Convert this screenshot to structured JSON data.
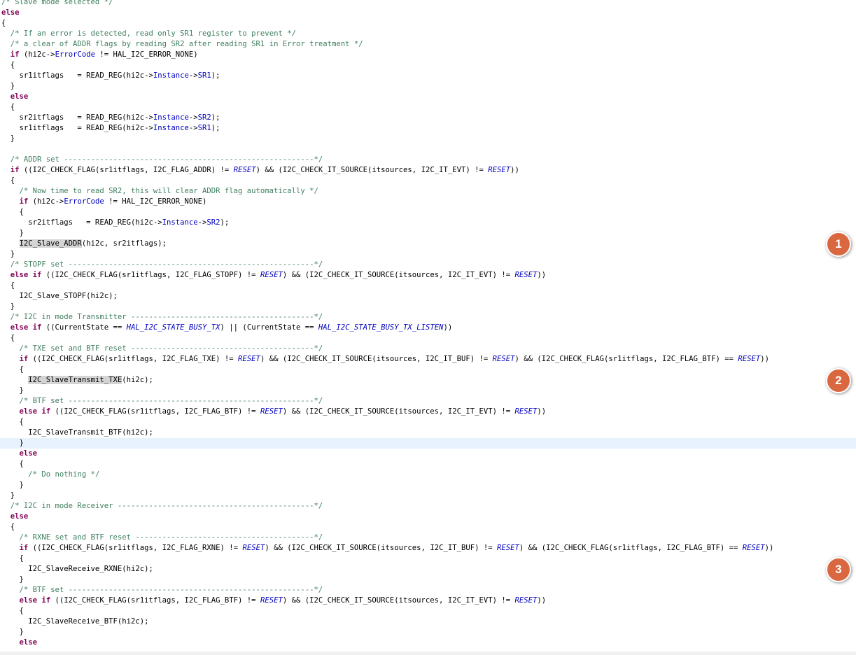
{
  "editor": {
    "current_line": 42,
    "lines": [
      [
        [
          "cm",
          "/* Slave mode selected */"
        ]
      ],
      [
        [
          "kw",
          "else"
        ]
      ],
      [
        [
          "t",
          "{"
        ]
      ],
      [
        [
          "t",
          "  "
        ],
        [
          "cm",
          "/* If an error is detected, read only SR1 register to prevent */"
        ]
      ],
      [
        [
          "t",
          "  "
        ],
        [
          "cm",
          "/* a clear of ADDR flags by reading SR2 after reading SR1 in Error treatment */"
        ]
      ],
      [
        [
          "t",
          "  "
        ],
        [
          "kw",
          "if"
        ],
        [
          "t",
          " (hi2c->"
        ],
        [
          "fld",
          "ErrorCode"
        ],
        [
          "t",
          " != HAL_I2C_ERROR_NONE)"
        ]
      ],
      [
        [
          "t",
          "  {"
        ]
      ],
      [
        [
          "t",
          "    sr1itflags   = READ_REG(hi2c->"
        ],
        [
          "fld",
          "Instance"
        ],
        [
          "t",
          "->"
        ],
        [
          "fld",
          "SR1"
        ],
        [
          "t",
          ");"
        ]
      ],
      [
        [
          "t",
          "  }"
        ]
      ],
      [
        [
          "t",
          "  "
        ],
        [
          "kw",
          "else"
        ]
      ],
      [
        [
          "t",
          "  {"
        ]
      ],
      [
        [
          "t",
          "    sr2itflags   = READ_REG(hi2c->"
        ],
        [
          "fld",
          "Instance"
        ],
        [
          "t",
          "->"
        ],
        [
          "fld",
          "SR2"
        ],
        [
          "t",
          ");"
        ]
      ],
      [
        [
          "t",
          "    sr1itflags   = READ_REG(hi2c->"
        ],
        [
          "fld",
          "Instance"
        ],
        [
          "t",
          "->"
        ],
        [
          "fld",
          "SR1"
        ],
        [
          "t",
          ");"
        ]
      ],
      [
        [
          "t",
          "  }"
        ]
      ],
      [],
      [
        [
          "t",
          "  "
        ],
        [
          "cm",
          "/* ADDR set --------------------------------------------------------*/"
        ]
      ],
      [
        [
          "t",
          "  "
        ],
        [
          "kw",
          "if"
        ],
        [
          "t",
          " ((I2C_CHECK_FLAG(sr1itflags, I2C_FLAG_ADDR) != "
        ],
        [
          "mac",
          "RESET"
        ],
        [
          "t",
          ") && (I2C_CHECK_IT_SOURCE(itsources, I2C_IT_EVT) != "
        ],
        [
          "mac",
          "RESET"
        ],
        [
          "t",
          "))"
        ]
      ],
      [
        [
          "t",
          "  {"
        ]
      ],
      [
        [
          "t",
          "    "
        ],
        [
          "cm",
          "/* Now time to read SR2, this will clear ADDR flag automatically */"
        ]
      ],
      [
        [
          "t",
          "    "
        ],
        [
          "kw",
          "if"
        ],
        [
          "t",
          " (hi2c->"
        ],
        [
          "fld",
          "ErrorCode"
        ],
        [
          "t",
          " != HAL_I2C_ERROR_NONE)"
        ]
      ],
      [
        [
          "t",
          "    {"
        ]
      ],
      [
        [
          "t",
          "      sr2itflags   = READ_REG(hi2c->"
        ],
        [
          "fld",
          "Instance"
        ],
        [
          "t",
          "->"
        ],
        [
          "fld",
          "SR2"
        ],
        [
          "t",
          ");"
        ]
      ],
      [
        [
          "t",
          "    }"
        ]
      ],
      [
        [
          "t",
          "    "
        ],
        [
          "sel",
          "I2C_Slave_ADDR"
        ],
        [
          "t",
          "(hi2c, sr2itflags);"
        ]
      ],
      [
        [
          "t",
          "  }"
        ]
      ],
      [
        [
          "t",
          "  "
        ],
        [
          "cm",
          "/* STOPF set -------------------------------------------------------*/"
        ]
      ],
      [
        [
          "t",
          "  "
        ],
        [
          "kw",
          "else if"
        ],
        [
          "t",
          " ((I2C_CHECK_FLAG(sr1itflags, I2C_FLAG_STOPF) != "
        ],
        [
          "mac",
          "RESET"
        ],
        [
          "t",
          ") && (I2C_CHECK_IT_SOURCE(itsources, I2C_IT_EVT) != "
        ],
        [
          "mac",
          "RESET"
        ],
        [
          "t",
          "))"
        ]
      ],
      [
        [
          "t",
          "  {"
        ]
      ],
      [
        [
          "t",
          "    I2C_Slave_STOPF(hi2c);"
        ]
      ],
      [
        [
          "t",
          "  }"
        ]
      ],
      [
        [
          "t",
          "  "
        ],
        [
          "cm",
          "/* I2C in mode Transmitter -----------------------------------------*/"
        ]
      ],
      [
        [
          "t",
          "  "
        ],
        [
          "kw",
          "else if"
        ],
        [
          "t",
          " ((CurrentState == "
        ],
        [
          "mac",
          "HAL_I2C_STATE_BUSY_TX"
        ],
        [
          "t",
          ") || (CurrentState == "
        ],
        [
          "mac",
          "HAL_I2C_STATE_BUSY_TX_LISTEN"
        ],
        [
          "t",
          "))"
        ]
      ],
      [
        [
          "t",
          "  {"
        ]
      ],
      [
        [
          "t",
          "    "
        ],
        [
          "cm",
          "/* TXE set and BTF reset -----------------------------------------*/"
        ]
      ],
      [
        [
          "t",
          "    "
        ],
        [
          "kw",
          "if"
        ],
        [
          "t",
          " ((I2C_CHECK_FLAG(sr1itflags, I2C_FLAG_TXE) != "
        ],
        [
          "mac",
          "RESET"
        ],
        [
          "t",
          ") && (I2C_CHECK_IT_SOURCE(itsources, I2C_IT_BUF) != "
        ],
        [
          "mac",
          "RESET"
        ],
        [
          "t",
          ") && (I2C_CHECK_FLAG(sr1itflags, I2C_FLAG_BTF) == "
        ],
        [
          "mac",
          "RESET"
        ],
        [
          "t",
          "))"
        ]
      ],
      [
        [
          "t",
          "    {"
        ]
      ],
      [
        [
          "t",
          "      "
        ],
        [
          "sel",
          "I2C_SlaveTransmit_TXE"
        ],
        [
          "t",
          "(hi2c);"
        ]
      ],
      [
        [
          "t",
          "    }"
        ]
      ],
      [
        [
          "t",
          "    "
        ],
        [
          "cm",
          "/* BTF set -------------------------------------------------------*/"
        ]
      ],
      [
        [
          "t",
          "    "
        ],
        [
          "kw",
          "else if"
        ],
        [
          "t",
          " ((I2C_CHECK_FLAG(sr1itflags, I2C_FLAG_BTF) != "
        ],
        [
          "mac",
          "RESET"
        ],
        [
          "t",
          ") && (I2C_CHECK_IT_SOURCE(itsources, I2C_IT_EVT) != "
        ],
        [
          "mac",
          "RESET"
        ],
        [
          "t",
          "))"
        ]
      ],
      [
        [
          "t",
          "    {"
        ]
      ],
      [
        [
          "t",
          "      I2C_SlaveTransmit_BTF(hi2c);"
        ]
      ],
      [
        [
          "t",
          "    }"
        ]
      ],
      [
        [
          "t",
          "    "
        ],
        [
          "kw",
          "else"
        ]
      ],
      [
        [
          "t",
          "    {"
        ]
      ],
      [
        [
          "t",
          "      "
        ],
        [
          "cm",
          "/* Do nothing */"
        ]
      ],
      [
        [
          "t",
          "    }"
        ]
      ],
      [
        [
          "t",
          "  }"
        ]
      ],
      [
        [
          "t",
          "  "
        ],
        [
          "cm",
          "/* I2C in mode Receiver --------------------------------------------*/"
        ]
      ],
      [
        [
          "t",
          "  "
        ],
        [
          "kw",
          "else"
        ]
      ],
      [
        [
          "t",
          "  {"
        ]
      ],
      [
        [
          "t",
          "    "
        ],
        [
          "cm",
          "/* RXNE set and BTF reset ----------------------------------------*/"
        ]
      ],
      [
        [
          "t",
          "    "
        ],
        [
          "kw",
          "if"
        ],
        [
          "t",
          " ((I2C_CHECK_FLAG(sr1itflags, I2C_FLAG_RXNE) != "
        ],
        [
          "mac",
          "RESET"
        ],
        [
          "t",
          ") && (I2C_CHECK_IT_SOURCE(itsources, I2C_IT_BUF) != "
        ],
        [
          "mac",
          "RESET"
        ],
        [
          "t",
          ") && (I2C_CHECK_FLAG(sr1itflags, I2C_FLAG_BTF) == "
        ],
        [
          "mac",
          "RESET"
        ],
        [
          "t",
          "))"
        ]
      ],
      [
        [
          "t",
          "    {"
        ]
      ],
      [
        [
          "t",
          "      I2C_SlaveReceive_RXNE(hi2c);"
        ]
      ],
      [
        [
          "t",
          "    }"
        ]
      ],
      [
        [
          "t",
          "    "
        ],
        [
          "cm",
          "/* BTF set -------------------------------------------------------*/"
        ]
      ],
      [
        [
          "t",
          "    "
        ],
        [
          "kw",
          "else if"
        ],
        [
          "t",
          " ((I2C_CHECK_FLAG(sr1itflags, I2C_FLAG_BTF) != "
        ],
        [
          "mac",
          "RESET"
        ],
        [
          "t",
          ") && (I2C_CHECK_IT_SOURCE(itsources, I2C_IT_EVT) != "
        ],
        [
          "mac",
          "RESET"
        ],
        [
          "t",
          "))"
        ]
      ],
      [
        [
          "t",
          "    {"
        ]
      ],
      [
        [
          "t",
          "      I2C_SlaveReceive_BTF(hi2c);"
        ]
      ],
      [
        [
          "t",
          "    }"
        ]
      ],
      [
        [
          "t",
          "    "
        ],
        [
          "kw",
          "else"
        ]
      ]
    ]
  },
  "annotations": [
    {
      "label": "1",
      "line": 23
    },
    {
      "label": "2",
      "line": 36
    },
    {
      "label": "3",
      "line": 54
    }
  ],
  "colors": {
    "keyword": "#7f0055",
    "comment": "#3f7f5f",
    "field": "#0000c0",
    "badge": "#d9673f",
    "current_line": "#e8f2fe"
  }
}
